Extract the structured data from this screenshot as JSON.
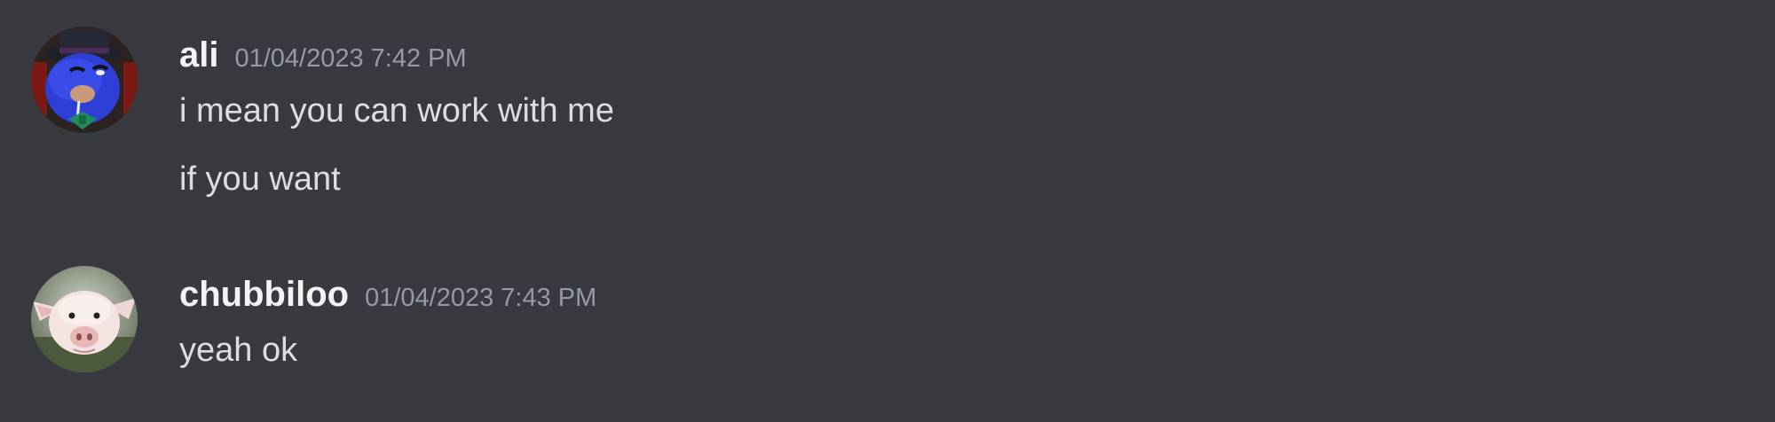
{
  "messages": [
    {
      "username": "ali",
      "timestamp": "01/04/2023 7:42 PM",
      "avatar_icon": "blue-character-avatar-icon",
      "lines": [
        "i mean you can work with me",
        "if you want"
      ]
    },
    {
      "username": "chubbiloo",
      "timestamp": "01/04/2023 7:43 PM",
      "avatar_icon": "pig-avatar-icon",
      "lines": [
        "yeah ok"
      ]
    }
  ],
  "colors": {
    "background": "#383a40",
    "username": "#f2f3f5",
    "timestamp": "#949ba4",
    "message_text": "#dbdee1"
  }
}
